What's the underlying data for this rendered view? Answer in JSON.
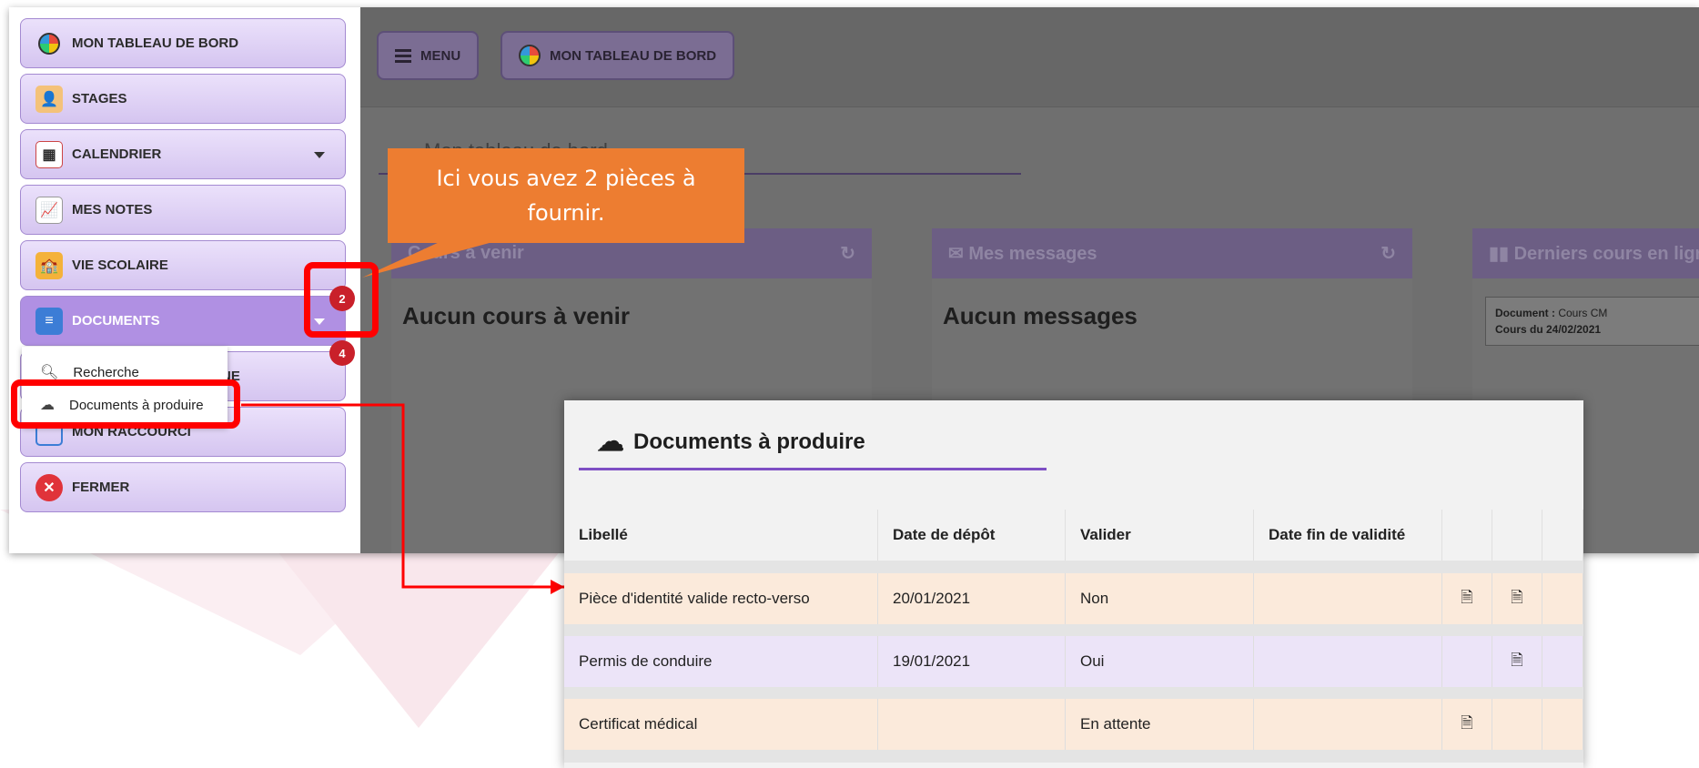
{
  "sidebar": {
    "items": [
      {
        "label": "MON TABLEAU DE BORD"
      },
      {
        "label": "STAGES"
      },
      {
        "label": "CALENDRIER"
      },
      {
        "label": "MES NOTES"
      },
      {
        "label": "VIE SCOLAIRE"
      },
      {
        "label": "DOCUMENTS"
      },
      {
        "label": "NE"
      },
      {
        "label": "MON RACCOURCI"
      },
      {
        "label": "FERMER"
      }
    ],
    "dropdown": [
      {
        "label": "Recherche",
        "icon": "search-icon"
      },
      {
        "label": "Documents à produire",
        "icon": "cloud-download-icon"
      }
    ],
    "badges": {
      "documents": "2",
      "submenu": "4"
    }
  },
  "topbar": {
    "menu_label": "MENU",
    "dashboard_label": "MON TABLEAU DE BORD"
  },
  "main": {
    "page_title": "Mon tableau de bord",
    "panels": [
      {
        "title": "Cours à venir",
        "body": "Aucun cours à venir"
      },
      {
        "title": "Mes messages",
        "body": "Aucun messages"
      },
      {
        "title": "Derniers cours en ligne",
        "doc_label": "Document :",
        "doc_value": "Cours CM",
        "doc_date": "Cours du 24/02/2021"
      }
    ]
  },
  "callout": {
    "text": "Ici vous avez 2 pièces à fournir."
  },
  "popup": {
    "title": "Documents à produire",
    "headers": [
      "Libellé",
      "Date de dépôt",
      "Valider",
      "Date fin de validité"
    ],
    "rows": [
      {
        "libelle": "Pièce d'identité valide recto-verso",
        "date": "20/01/2021",
        "valider": "Non",
        "fin": "",
        "upload": true,
        "download": true,
        "color": "#fbeadb"
      },
      {
        "libelle": "Permis de conduire",
        "date": "19/01/2021",
        "valider": "Oui",
        "fin": "",
        "upload": false,
        "download": true,
        "color": "#ece4f8"
      },
      {
        "libelle": "Certificat médical",
        "date": "",
        "valider": "En attente",
        "fin": "",
        "upload": true,
        "download": false,
        "color": "#fbeadb"
      }
    ]
  },
  "colors": {
    "accent": "#7e4fc4",
    "callout": "#ed7d31",
    "highlight": "#ff0000",
    "badge": "#c9202a"
  }
}
